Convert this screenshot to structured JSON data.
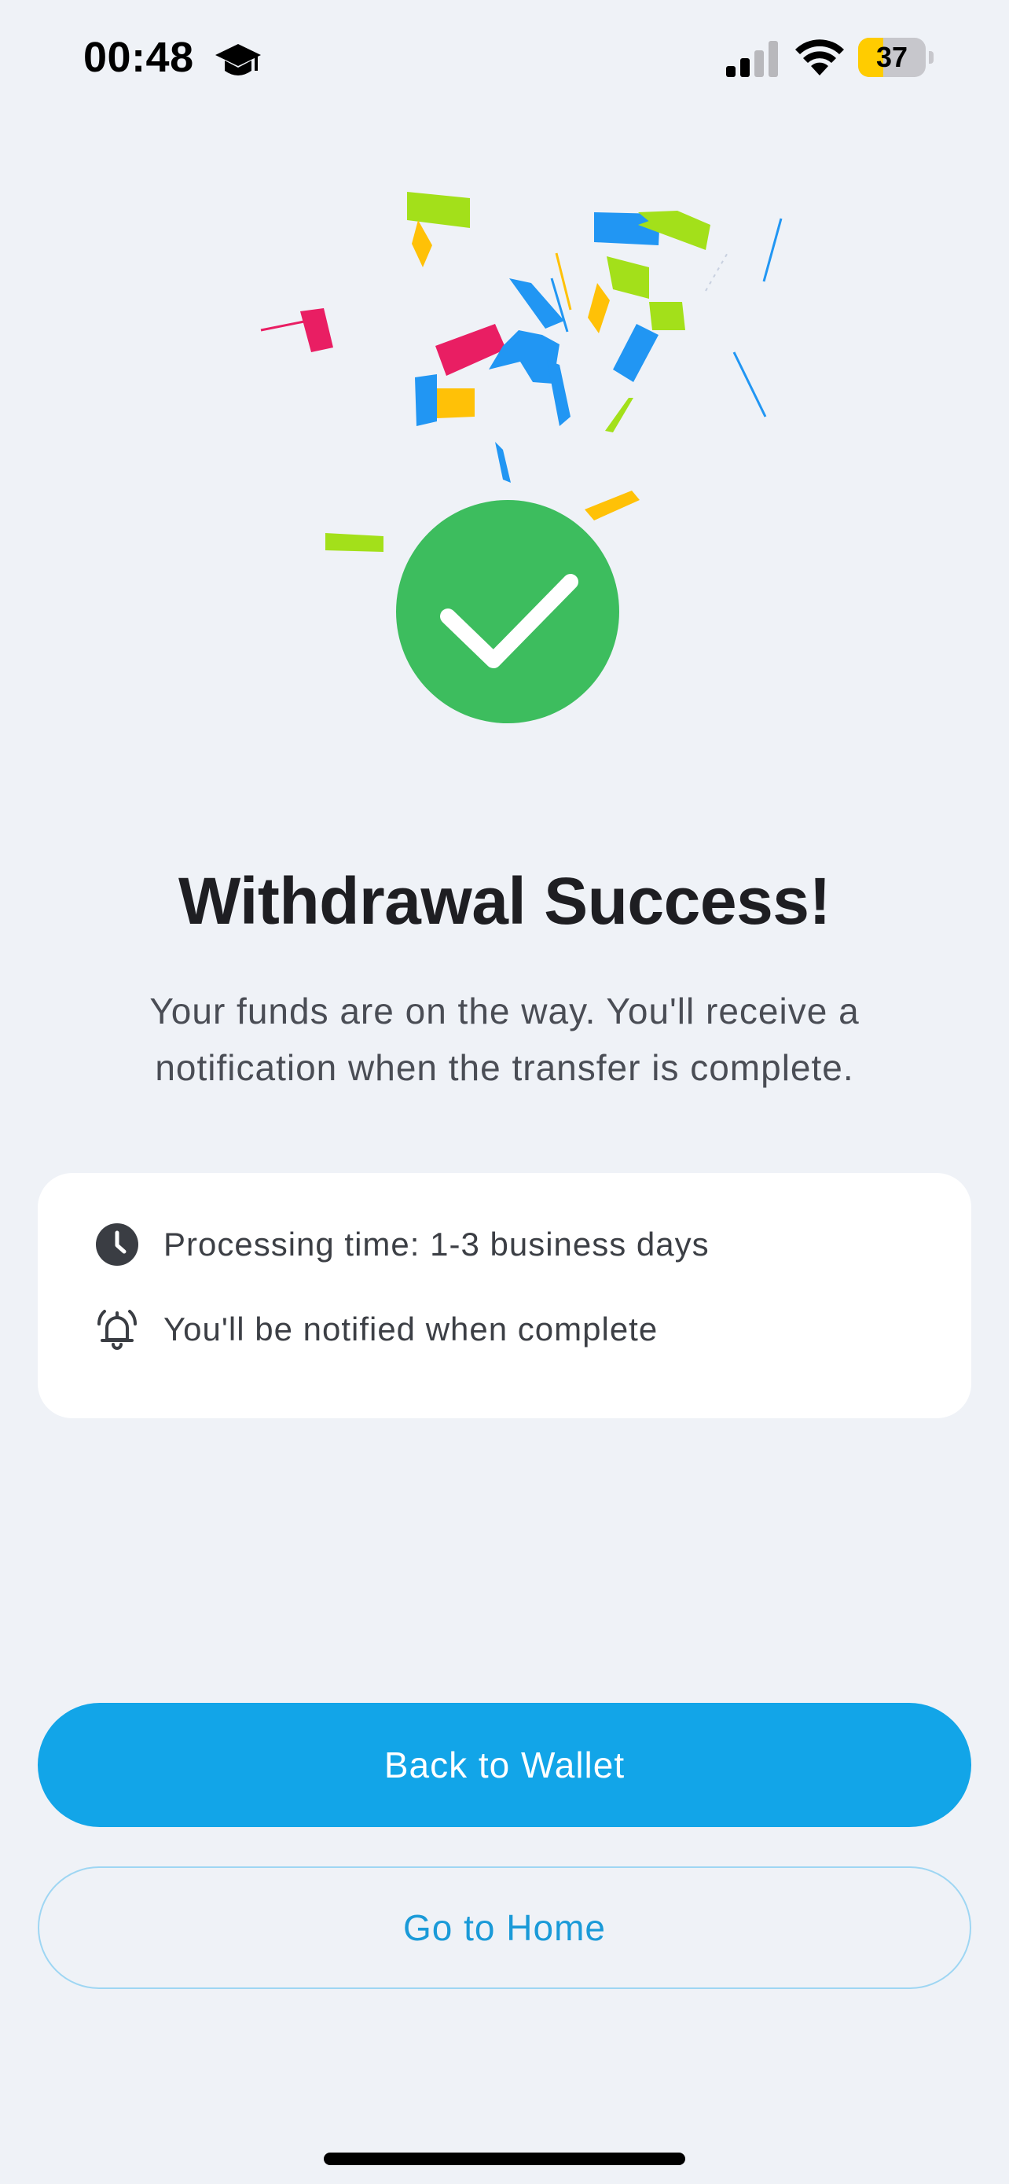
{
  "status_bar": {
    "time": "00:48",
    "battery_level": 37,
    "battery_text": "37",
    "icons": [
      "graduation-cap-icon",
      "cellular-signal-icon",
      "wifi-icon",
      "battery-icon"
    ]
  },
  "hero": {
    "icon": "check-circle-icon",
    "check_color": "#3dbd5e",
    "confetti_colors": [
      "#a3e01a",
      "#2196f3",
      "#e91e63",
      "#ffc107"
    ]
  },
  "headline": "Withdrawal Success!",
  "subtitle": "Your funds are on the way. You'll receive a notification when the transfer is complete.",
  "info_card": {
    "items": [
      {
        "icon": "clock-icon",
        "text": "Processing time: 1-3 business days"
      },
      {
        "icon": "alarm-bell-icon",
        "text": "You'll be notified when complete"
      }
    ]
  },
  "actions": {
    "primary_label": "Back to Wallet",
    "secondary_label": "Go to Home",
    "primary_color": "#12a5e8"
  }
}
